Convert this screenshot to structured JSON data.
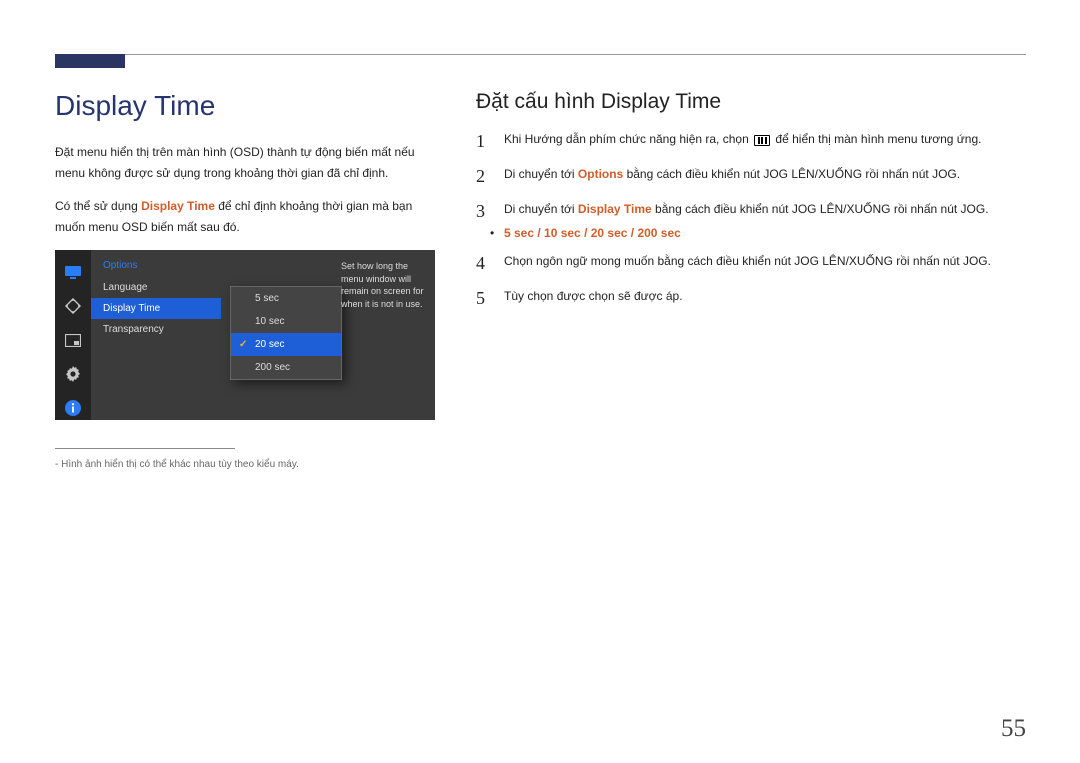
{
  "page_number": "55",
  "left": {
    "title": "Display Time",
    "para1": "Đặt menu hiển thị trên màn hình (OSD) thành tự động biến mất nếu menu không được sử dụng trong khoảng thời gian đã chỉ định.",
    "para2_pre": "Có thể sử dụng ",
    "para2_hl": "Display Time",
    "para2_post": " để chỉ định khoảng thời gian mà bạn muốn menu OSD biến mất sau đó."
  },
  "osd": {
    "header": "Options",
    "items": [
      "Language",
      "Display Time",
      "Transparency"
    ],
    "selected_index": 1,
    "submenu": {
      "items": [
        "5 sec",
        "10 sec",
        "20 sec",
        "200 sec"
      ],
      "selected_index": 2
    },
    "description": "Set how long the menu window will remain on screen for when it is not in use."
  },
  "footnote": "Hình ảnh hiển thị có thể khác nhau tùy theo kiểu máy.",
  "right": {
    "title": "Đặt cấu hình Display Time",
    "steps": {
      "s1_pre": "Khi Hướng dẫn phím chức năng hiện ra, chọn ",
      "s1_post": " để hiển thị màn hình menu tương ứng.",
      "s2_pre": "Di chuyển tới ",
      "s2_hl": "Options",
      "s2_post": " bằng cách điều khiển nút JOG LÊN/XUỐNG rồi nhấn nút JOG.",
      "s3_pre": "Di chuyển tới ",
      "s3_hl": "Display Time",
      "s3_post": " bằng cách điều khiển nút JOG LÊN/XUỐNG rồi nhấn nút JOG.",
      "bullet": "5 sec / 10 sec / 20 sec / 200 sec",
      "s4": "Chọn ngôn ngữ mong muốn bằng cách điều khiển nút JOG LÊN/XUỐNG rồi nhấn nút JOG.",
      "s5": "Tùy chọn được chọn sẽ được áp."
    }
  }
}
